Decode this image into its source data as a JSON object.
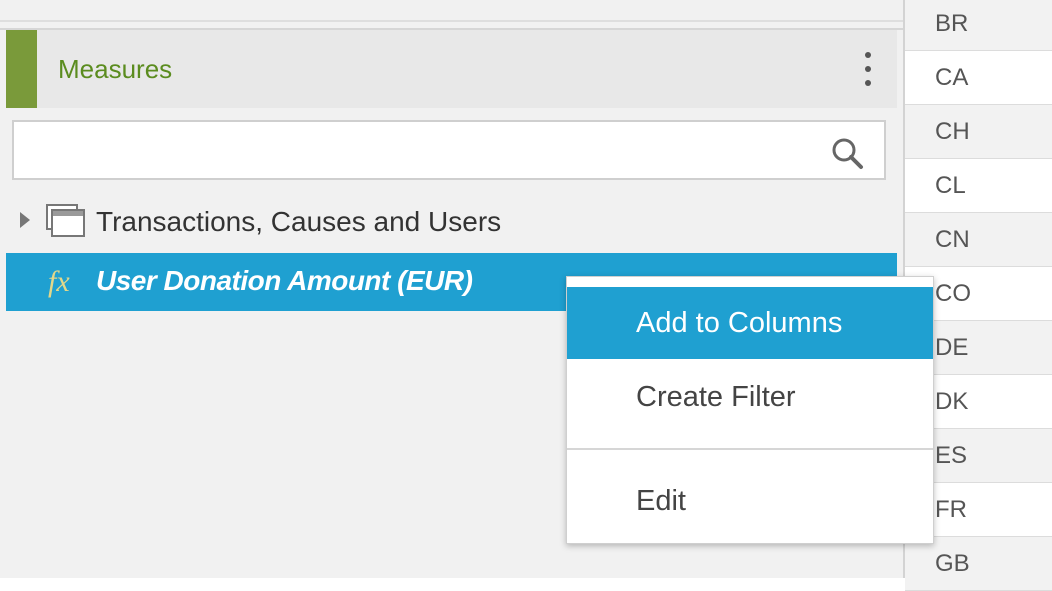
{
  "colors": {
    "accent_green": "#7a9a3a",
    "measures_title": "#5b8c1f",
    "selection_blue": "#1fa0d1",
    "fx_icon": "#e3d88a",
    "panel_bg": "#f1f1f1"
  },
  "measures_panel": {
    "title": "Measures",
    "search_placeholder": "",
    "tree": [
      {
        "label": "Transactions, Causes and Users",
        "icon": "folder-stack-icon",
        "expanded": false
      }
    ],
    "selected_measure": {
      "prefix": "fx",
      "label": "User Donation Amount (EUR)"
    }
  },
  "context_menu": {
    "items": [
      {
        "label": "Add to Columns",
        "active": true
      },
      {
        "label": "Create Filter",
        "active": false
      },
      {
        "label": "Edit",
        "active": false
      }
    ]
  },
  "country_column": [
    "BR",
    "CA",
    "CH",
    "CL",
    "CN",
    "CO",
    "DE",
    "DK",
    "ES",
    "FR",
    "GB"
  ]
}
